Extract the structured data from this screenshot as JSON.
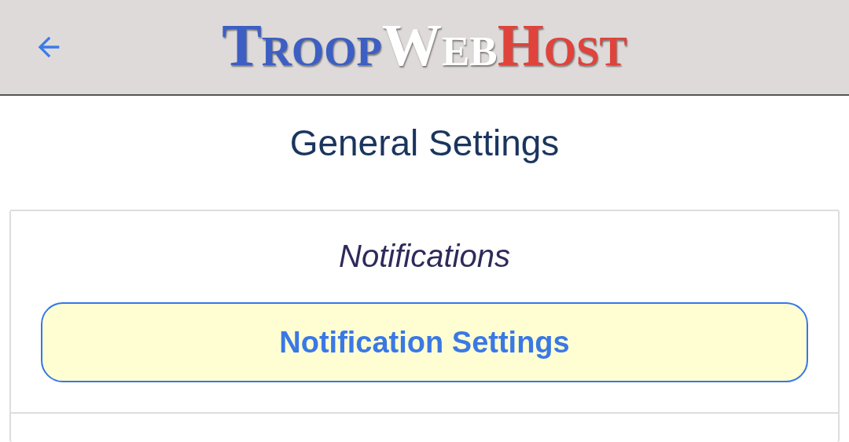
{
  "header": {
    "logo_parts": [
      {
        "text": "Troop",
        "color": "#3d5fc4"
      },
      {
        "text": "Web",
        "color": "#ffffff"
      },
      {
        "text": "Host",
        "color": "#e0433b"
      }
    ]
  },
  "page_title": "General Settings",
  "section": {
    "heading": "Notifications",
    "button": "Notification Settings"
  }
}
